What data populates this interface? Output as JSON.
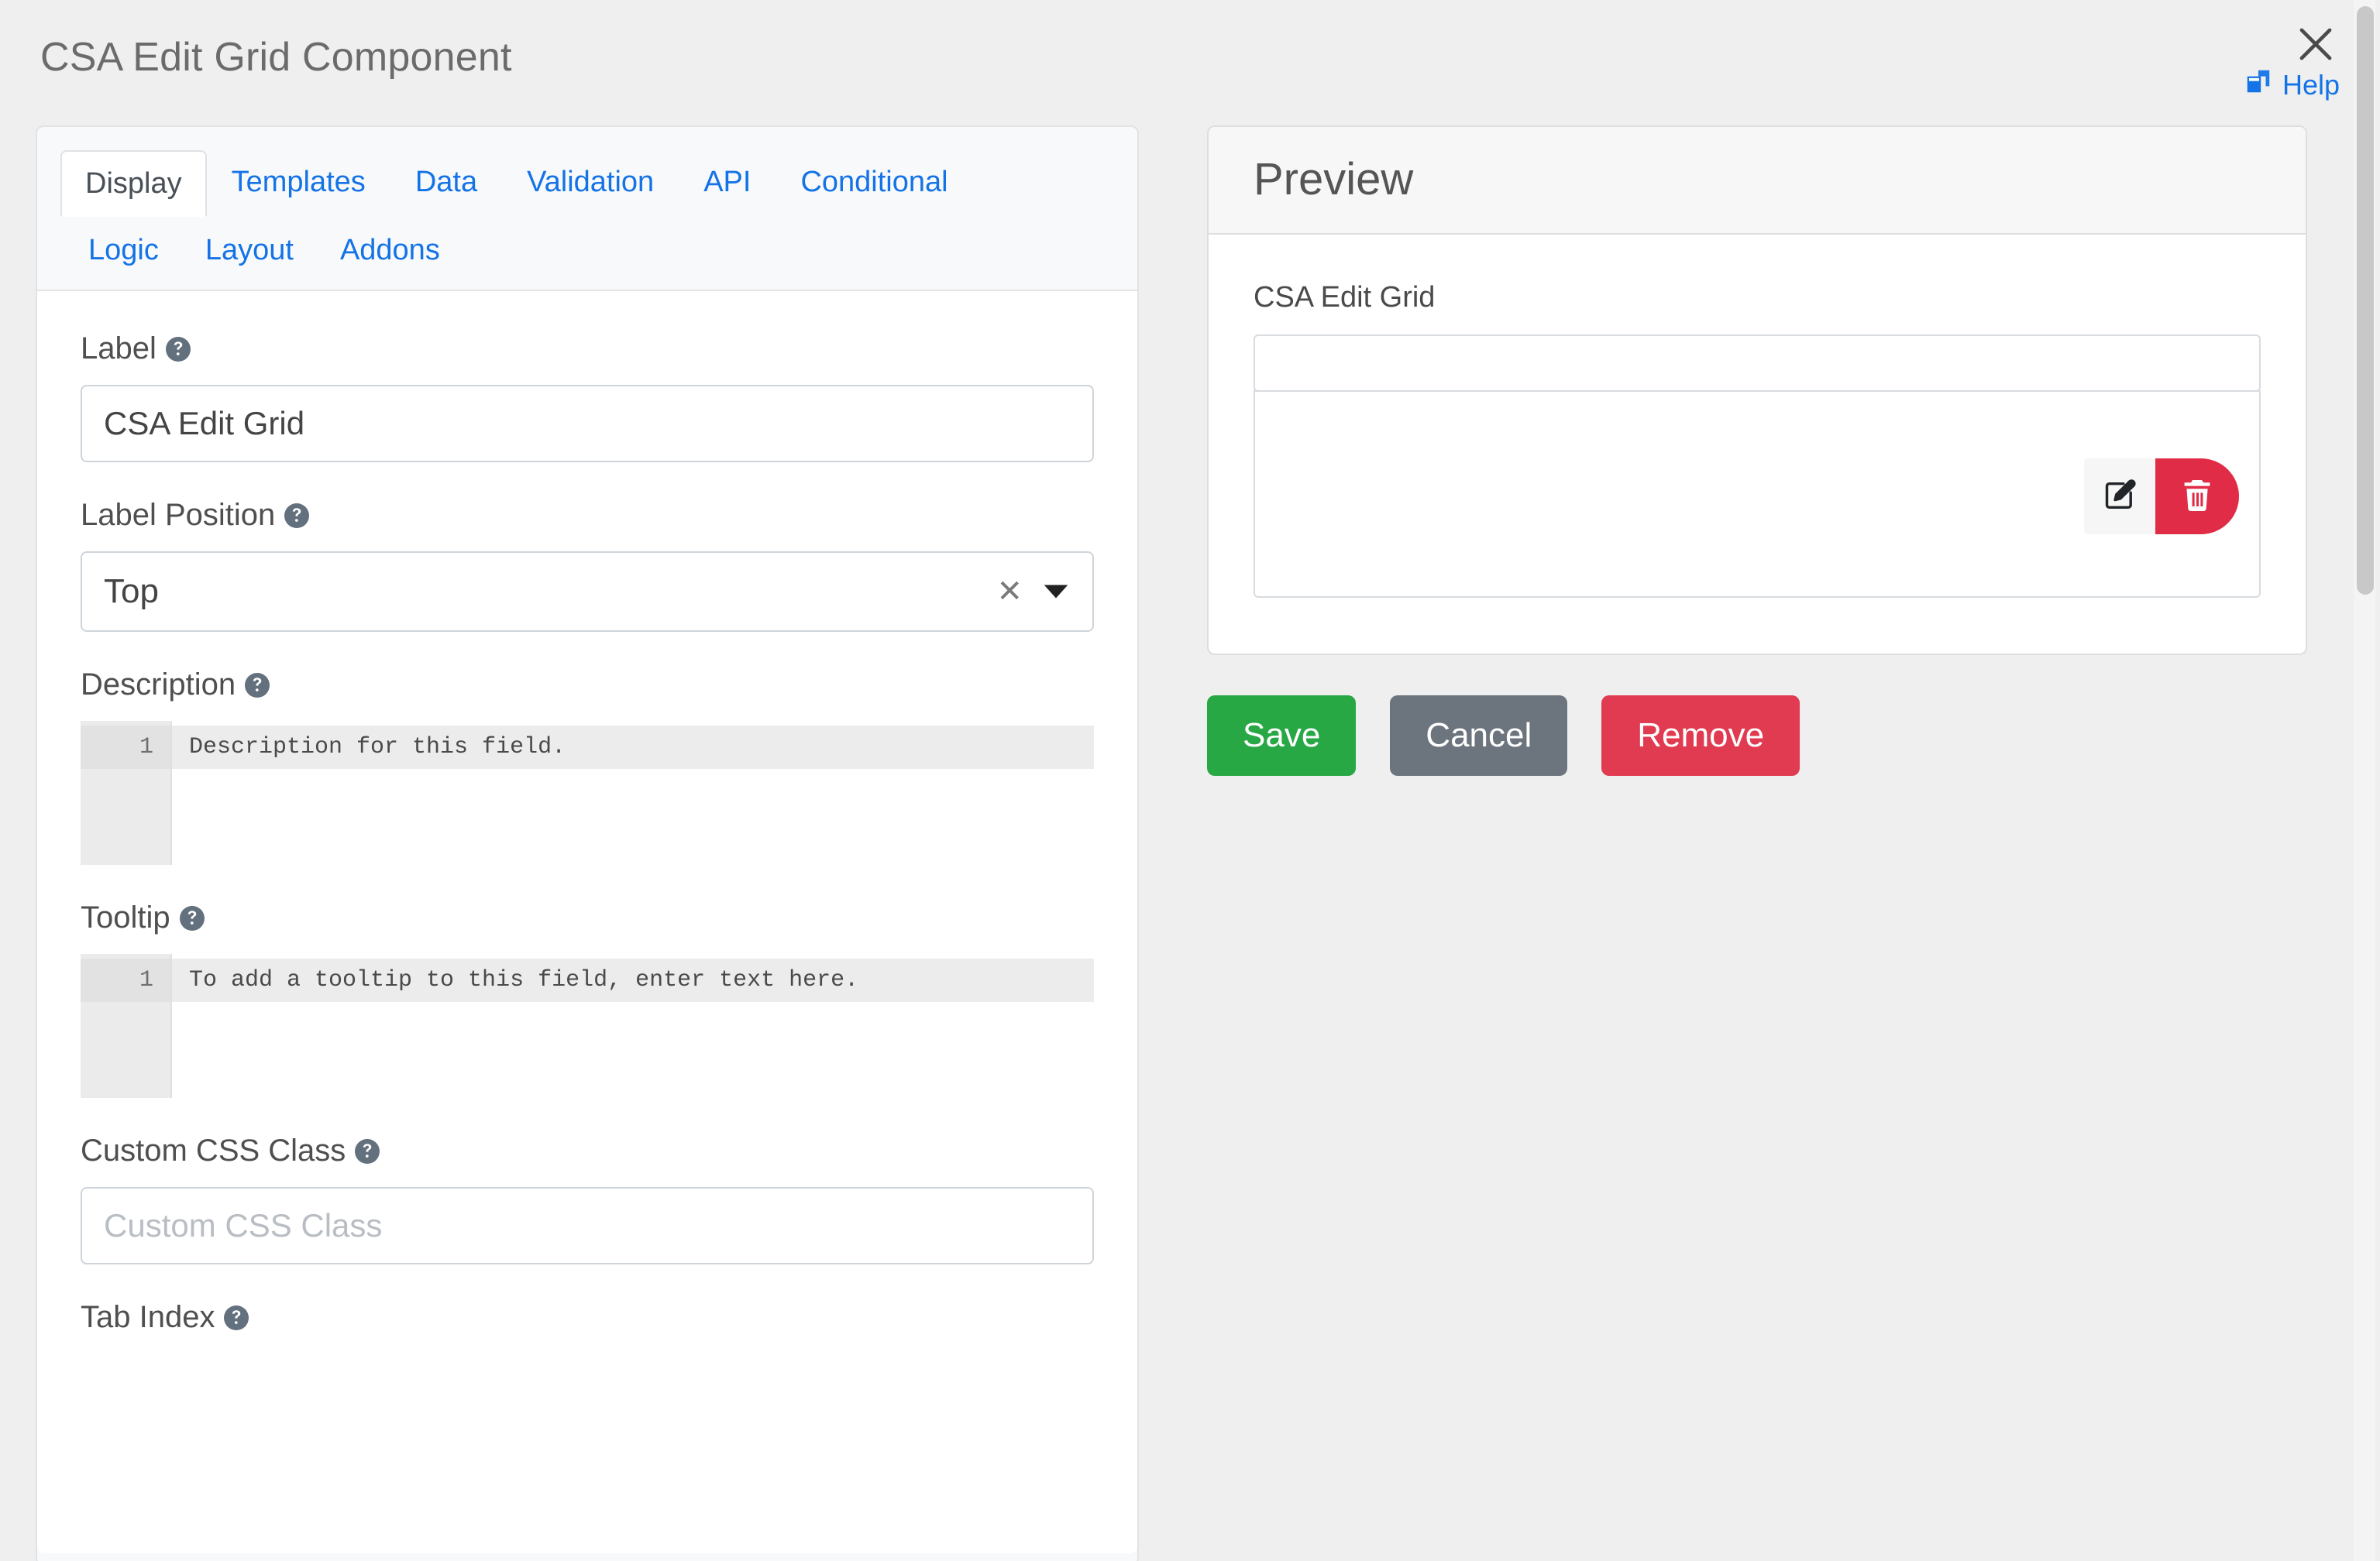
{
  "header": {
    "title": "CSA Edit Grid Component",
    "help_label": "Help",
    "help_icon": "window-restore-icon",
    "close_icon": "close-icon"
  },
  "tabs": {
    "row1": [
      {
        "label": "Display",
        "active": true
      },
      {
        "label": "Templates",
        "active": false
      },
      {
        "label": "Data",
        "active": false
      },
      {
        "label": "Validation",
        "active": false
      },
      {
        "label": "API",
        "active": false
      },
      {
        "label": "Conditional",
        "active": false
      }
    ],
    "row2": [
      {
        "label": "Logic"
      },
      {
        "label": "Layout"
      },
      {
        "label": "Addons"
      }
    ]
  },
  "form": {
    "label_field": {
      "label": "Label",
      "help_icon": "question-circle-icon",
      "value": "CSA Edit Grid",
      "placeholder": ""
    },
    "label_position": {
      "label": "Label Position",
      "help_icon": "question-circle-icon",
      "value": "Top",
      "clear_icon": "clear-x-icon",
      "caret_icon": "chevron-down-icon"
    },
    "description": {
      "label": "Description",
      "help_icon": "question-circle-icon",
      "line_number": "1",
      "text": "Description for this field."
    },
    "tooltip": {
      "label": "Tooltip",
      "help_icon": "question-circle-icon",
      "line_number": "1",
      "text": "To add a tooltip to this field, enter text here."
    },
    "custom_css_class": {
      "label": "Custom CSS Class",
      "help_icon": "question-circle-icon",
      "value": "",
      "placeholder": "Custom CSS Class"
    },
    "tab_index": {
      "label": "Tab Index",
      "help_icon": "question-circle-icon"
    }
  },
  "preview": {
    "title": "Preview",
    "field_label": "CSA Edit Grid",
    "input_value": "",
    "row_edit_icon": "edit-pencil-square-icon",
    "row_delete_icon": "trash-icon"
  },
  "actions": {
    "save": "Save",
    "cancel": "Cancel",
    "remove": "Remove"
  },
  "colors": {
    "accent_blue": "#1473e6",
    "save_green": "#28a745",
    "cancel_gray": "#6c757d",
    "remove_red": "#e13b51",
    "page_bg": "#efefef"
  }
}
